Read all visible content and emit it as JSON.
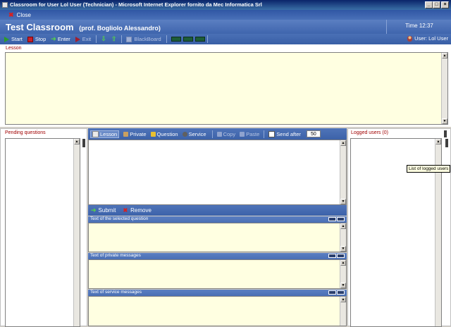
{
  "window": {
    "title": "Classroom for User Lol User (Technician) - Microsoft Internet Explorer fornito da Mec Informatica Srl"
  },
  "closebar": {
    "close_label": "Close"
  },
  "header": {
    "title": "Test Classroom",
    "teacher": "(prof. Bogliolo Alessandro)",
    "time": "Time 12:37"
  },
  "toolbar": {
    "start": "Start",
    "stop": "Stop",
    "enter": "Enter",
    "exit": "Exit",
    "blackboard": "BlackBoard",
    "user": "User: Lol User"
  },
  "lesson": {
    "label": "Lesson"
  },
  "pending": {
    "label": "Pending questions"
  },
  "tabs": {
    "lesson": "Lesson",
    "private": "Private",
    "question": "Question",
    "service": "Service",
    "copy": "Copy",
    "paste": "Paste",
    "send_after": "Send after",
    "send_after_value": "50"
  },
  "actions": {
    "submit": "Submit",
    "remove": "Remove"
  },
  "sections": {
    "selected_question": "Text of the selected question",
    "private_messages": "Text of private messages",
    "service_messages": "Text of service messages"
  },
  "logged": {
    "label": "Logged users (0)",
    "tooltip": "List of logged users"
  },
  "colors": {
    "titlebar": "#0a246a",
    "toolbar_blue": "#4a70b6",
    "pane_yellow": "#ffffe1",
    "label_red": "#a00000"
  }
}
